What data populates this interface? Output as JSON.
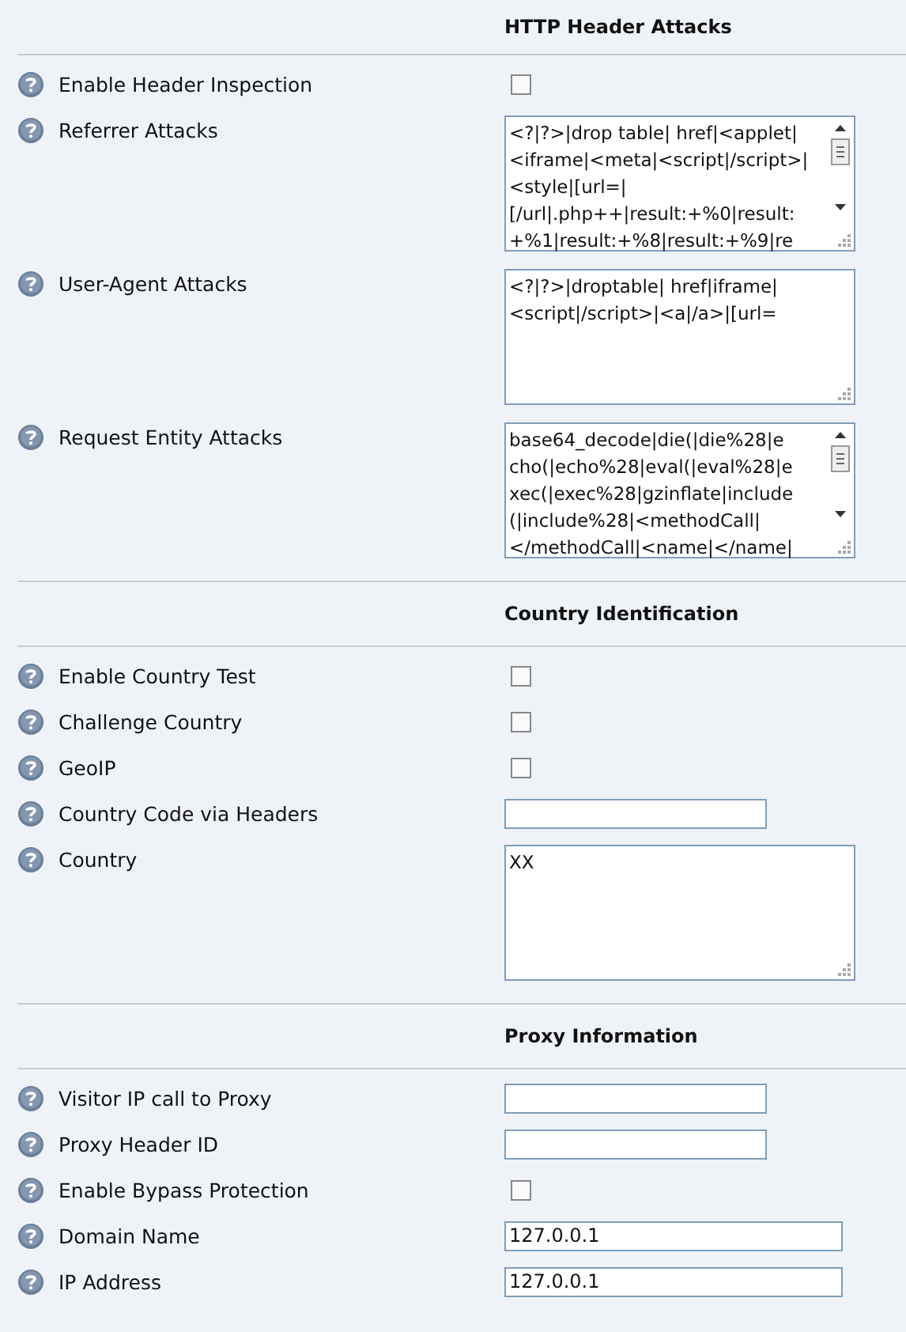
{
  "sections": [
    {
      "title": "HTTP Header Attacks",
      "rows": [
        {
          "label": "Enable Header Inspection",
          "kind": "checkbox",
          "checked": false
        },
        {
          "label": "Referrer Attacks",
          "kind": "textarea",
          "scrollable": true,
          "value": "<?|?>|drop table| href|<applet|\n<iframe|<meta|<script|/script>|\n<style|[url=|\n[/url|.php++|result:+%0|result:\n+%1|result:+%8|result:+%9|re"
        },
        {
          "label": "User-Agent Attacks",
          "kind": "textarea",
          "scrollable": false,
          "value": "<?|?>|droptable| href|iframe|\n<script|/script>|<a|/a>|[url="
        },
        {
          "label": "Request Entity Attacks",
          "kind": "textarea",
          "scrollable": true,
          "value": "base64_decode|die(|die%28|e\ncho(|echo%28|eval(|eval%28|e\nxec(|exec%28|gzinflate|include\n(|include%28|<methodCall|\n</methodCall|<name|</name|"
        }
      ]
    },
    {
      "title": "Country Identification",
      "rows": [
        {
          "label": "Enable Country Test",
          "kind": "checkbox",
          "checked": false
        },
        {
          "label": "Challenge Country",
          "kind": "checkbox",
          "checked": false
        },
        {
          "label": "GeoIP",
          "kind": "checkbox",
          "checked": false
        },
        {
          "label": "Country Code via Headers",
          "kind": "input"
        },
        {
          "label": "Country",
          "kind": "textarea",
          "scrollable": false,
          "value": "XX"
        }
      ]
    },
    {
      "title": "Proxy Information",
      "rows": [
        {
          "label": "Visitor IP call to Proxy",
          "kind": "input"
        },
        {
          "label": "Proxy Header ID",
          "kind": "input"
        },
        {
          "label": "Enable Bypass Protection",
          "kind": "checkbox",
          "checked": false
        },
        {
          "label": "Domain Name",
          "kind": "input",
          "value": "127.0.0.1"
        },
        {
          "label": "IP Address",
          "kind": "input",
          "value": "127.0.0.1"
        }
      ]
    }
  ]
}
